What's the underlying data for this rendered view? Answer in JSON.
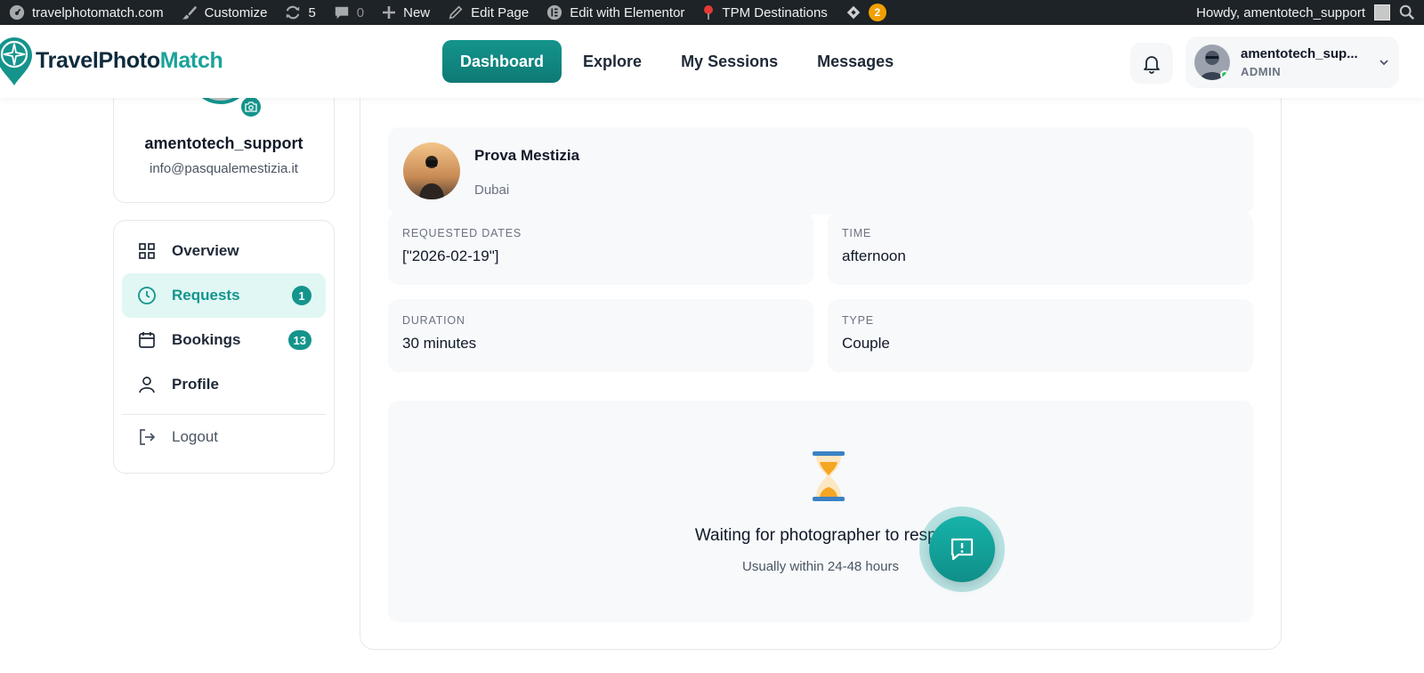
{
  "admin_bar": {
    "site": "travelphotomatch.com",
    "customize": "Customize",
    "updates_count": "5",
    "comments_count": "0",
    "new": "New",
    "edit_page": "Edit Page",
    "edit_elementor": "Edit with Elementor",
    "destinations": "TPM Destinations",
    "plugin_badge": "2",
    "howdy": "Howdy, amentotech_support"
  },
  "header": {
    "logo_part1": "TravelPhoto",
    "logo_part2": "Match",
    "nav": [
      {
        "label": "Dashboard",
        "active": true
      },
      {
        "label": "Explore"
      },
      {
        "label": "My Sessions"
      },
      {
        "label": "Messages"
      }
    ],
    "user": {
      "name": "amentotech_sup...",
      "role": "ADMIN"
    }
  },
  "profile": {
    "username": "amentotech_support",
    "email": "info@pasqualemestizia.it"
  },
  "menu": {
    "overview": "Overview",
    "requests": "Requests",
    "requests_count": "1",
    "bookings": "Bookings",
    "bookings_count": "13",
    "profile": "Profile",
    "logout": "Logout"
  },
  "request": {
    "photographer_name": "Prova Mestizia",
    "location": "Dubai",
    "dates_label": "REQUESTED DATES",
    "dates_value": "[\"2026-02-19\"]",
    "time_label": "TIME",
    "time_value": "afternoon",
    "duration_label": "DURATION",
    "duration_value": "30 minutes",
    "type_label": "TYPE",
    "type_value": "Couple",
    "waiting_title": "Waiting for photographer to respo",
    "waiting_subtitle": "Usually within 24-48 hours"
  },
  "colors": {
    "accent": "#14948c",
    "admin_bar": "#1d2327",
    "card_bg": "#f7f9fb",
    "badge_orange": "#f0a000"
  }
}
